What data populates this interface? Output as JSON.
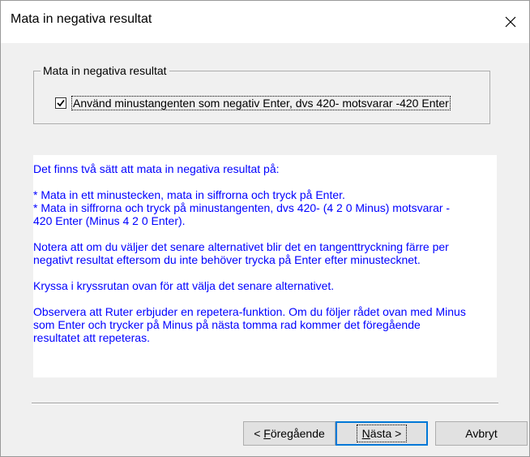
{
  "window": {
    "title": "Mata in negativa resultat",
    "close_icon": "close-icon"
  },
  "group": {
    "legend": "Mata in negativa resultat",
    "checkbox_checked": true,
    "checkbox_label": "Använd minustangenten som negativ Enter, dvs 420- motsvarar -420 Enter"
  },
  "info": {
    "paragraphs": [
      "Det finns två sätt att mata in negativa resultat på:",
      "* Mata in ett minustecken, mata in siffrorna och tryck på Enter.\n* Mata in siffrorna och tryck på minustangenten, dvs 420- (4 2 0 Minus) motsvarar -\n420 Enter (Minus 4 2 0 Enter).",
      "Notera att om du väljer det senare alternativet blir det en tangenttryckning färre per\nnegativt resultat eftersom du inte behöver trycka på Enter efter minustecknet.",
      "Kryssa i kryssrutan ovan för att välja det senare alternativet.",
      "Observera att Ruter erbjuder en repetera-funktion. Om du följer rådet ovan med Minus\nsom Enter och trycker på Minus på nästa tomma rad kommer det föregående\nresultatet att repeteras."
    ]
  },
  "buttons": {
    "back_prefix": "< ",
    "back_mnemonic": "F",
    "back_rest": "öregående",
    "next_mnemonic": "N",
    "next_rest": "ästa >",
    "cancel": "Avbryt"
  },
  "colors": {
    "info_text": "#0000ff",
    "dialog_bg": "#f0f0f0",
    "default_button_border": "#0078d7"
  }
}
